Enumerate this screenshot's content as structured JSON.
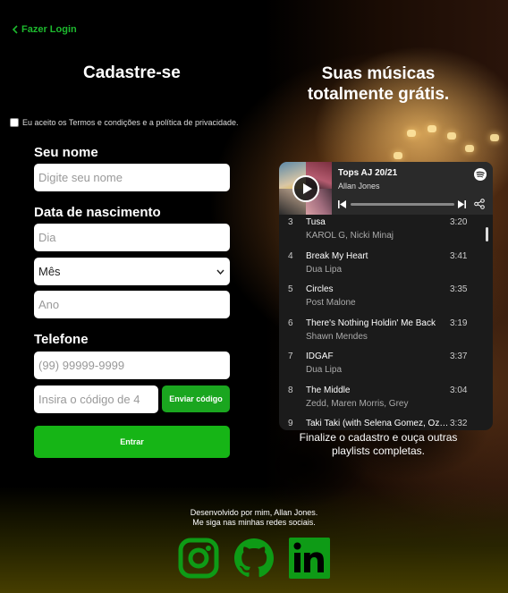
{
  "nav": {
    "login_label": "Fazer Login"
  },
  "form": {
    "title": "Cadastre-se",
    "terms_label": "Eu aceito os Termos e condições e a política de privacidade.",
    "name_label": "Seu nome",
    "name_placeholder": "Digite seu nome",
    "birth_label": "Data de nascimento",
    "day_placeholder": "Dia",
    "month_selected": "Mês",
    "year_placeholder": "Ano",
    "phone_label": "Telefone",
    "phone_placeholder": "(99) 99999-9999",
    "code_placeholder": "Insira o código de 4",
    "send_code_label": "Enviar código",
    "submit_label": "Entrar"
  },
  "promo": {
    "title_line1": "Suas músicas",
    "title_line2": "totalmente grátis.",
    "finalize_line1": "Finalize o cadastro e ouça outras",
    "finalize_line2": "playlists completas."
  },
  "player": {
    "playlist_title": "Tops AJ 20/21",
    "playlist_owner": "Allan Jones",
    "tracks": [
      {
        "num": "3",
        "name": "Tusa",
        "artist": "KAROL G, Nicki Minaj",
        "duration": "3:20"
      },
      {
        "num": "4",
        "name": "Break My Heart",
        "artist": "Dua Lipa",
        "duration": "3:41"
      },
      {
        "num": "5",
        "name": "Circles",
        "artist": "Post Malone",
        "duration": "3:35"
      },
      {
        "num": "6",
        "name": "There's Nothing Holdin' Me Back",
        "artist": "Shawn Mendes",
        "duration": "3:19"
      },
      {
        "num": "7",
        "name": "IDGAF",
        "artist": "Dua Lipa",
        "duration": "3:37"
      },
      {
        "num": "8",
        "name": "The Middle",
        "artist": "Zedd, Maren Morris, Grey",
        "duration": "3:04"
      },
      {
        "num": "9",
        "name": "Taki Taki (with Selena Gomez, Ozuna & Cardi B)",
        "artist": "",
        "duration": "3:32"
      }
    ]
  },
  "footer": {
    "line1": "Desenvolvido por mim, Allan Jones.",
    "line2": "Me siga nas minhas redes sociais."
  },
  "colors": {
    "accent": "#1aa61f",
    "social": "#0e9b16"
  },
  "icons": [
    "chevron-left-icon",
    "play-icon",
    "spotify-icon",
    "previous-icon",
    "next-icon",
    "share-icon",
    "chevron-down-icon",
    "instagram-icon",
    "github-icon",
    "linkedin-icon"
  ]
}
